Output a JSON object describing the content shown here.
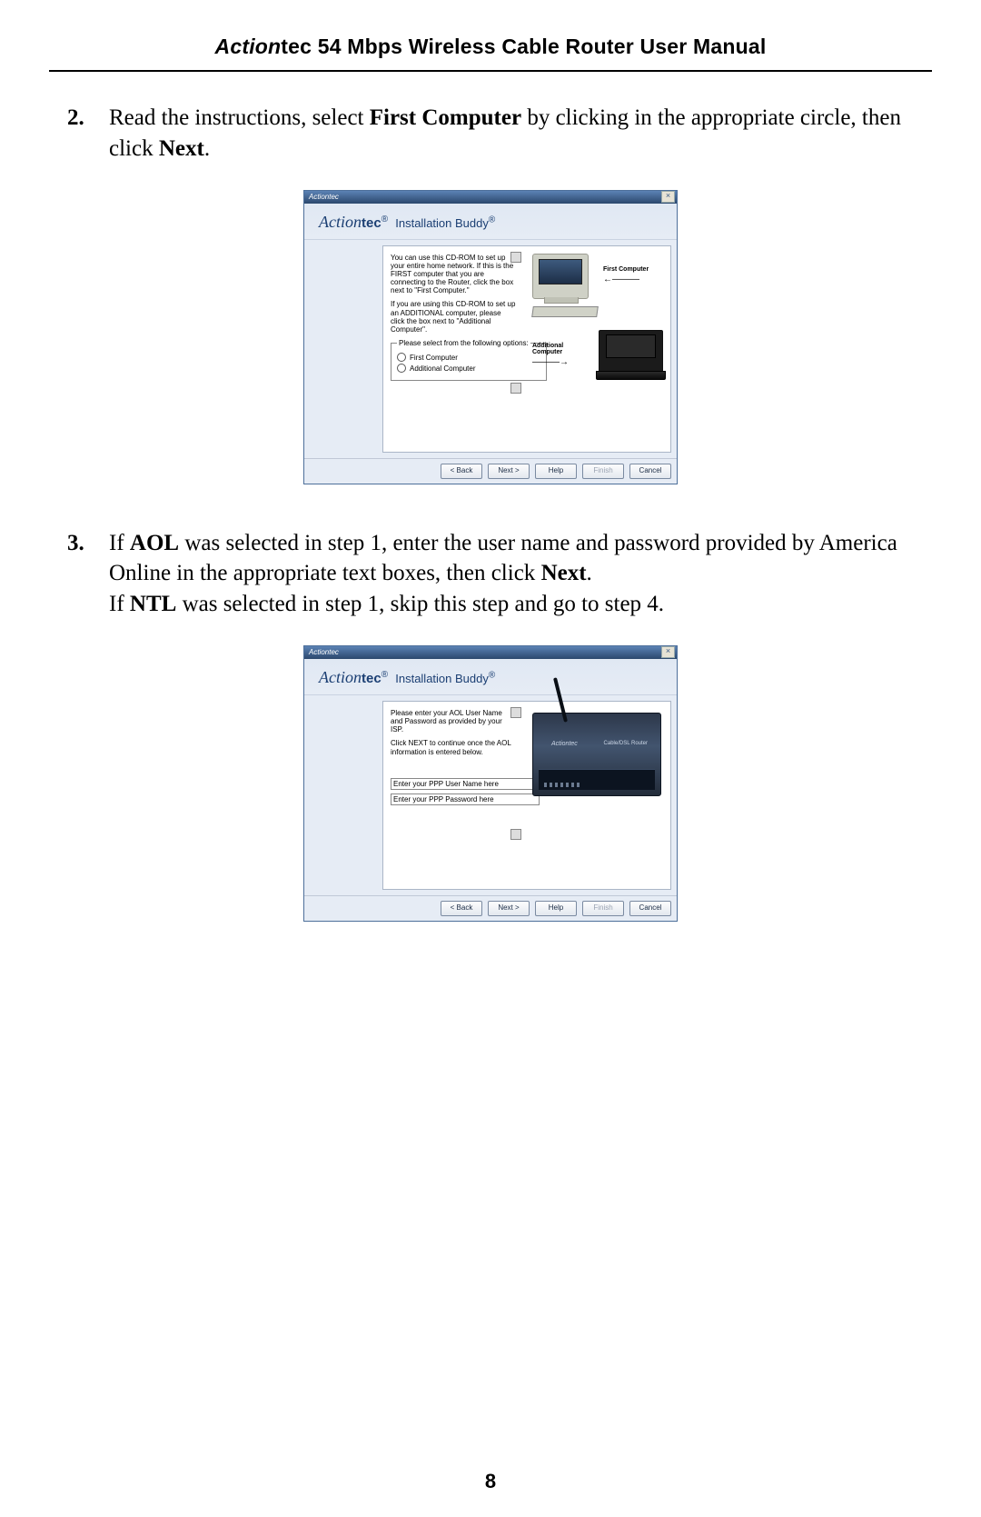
{
  "header": {
    "brand_italic": "Action",
    "brand_rest": "tec 54 Mbps Wireless Cable Router User Manual"
  },
  "steps": {
    "s2": {
      "num": "2.",
      "text_a": "Read the instructions, select ",
      "bold_a": "First Computer",
      "text_b": " by clicking in the appropriate circle, then click ",
      "bold_b": "Next",
      "text_c": "."
    },
    "s3": {
      "num": "3.",
      "line1_a": "If ",
      "line1_bold1": "AOL",
      "line1_b": " was selected in step 1, enter the user name and password provided by America Online in the appropriate text boxes, then click ",
      "line1_bold2": "Next",
      "line1_c": ".",
      "line2_a": "If ",
      "line2_bold": "NTL",
      "line2_b": " was selected in step 1, skip this step and go to step 4."
    }
  },
  "wizard_common": {
    "titlebar_logo": "Actiontec",
    "close": "×",
    "brand_ital": "Action",
    "brand_bold": "tec",
    "brand_reg": "®",
    "product": " Installation Buddy",
    "product_reg": "®",
    "btn_back": "< Back",
    "btn_next": "Next >",
    "btn_help": "Help",
    "btn_finish": "Finish",
    "btn_cancel": "Cancel"
  },
  "wizard1": {
    "instr_p1": "You can use this CD-ROM to set up your entire home network.  If this is the FIRST computer that you are connecting to the Router, click the box next to \"First Computer.\"",
    "instr_p2": "If you are using this CD-ROM to set up an ADDITIONAL computer, please click the box next to \"Additional Computer\".",
    "legend": "Please select from the following options:",
    "opt1": "First Computer",
    "opt2": "Additional Computer",
    "label_first": "First Computer",
    "label_additional": "Additional Computer"
  },
  "wizard2": {
    "instr_p1": "Please enter your AOL User Name and Password as provided by your ISP.",
    "instr_p2": "Click NEXT to continue once the AOL information is entered below.",
    "input_user": "Enter your PPP User Name here",
    "input_pass": "Enter your PPP Password here",
    "router_brand": "Actiontec",
    "router_model": "Cable/DSL Router"
  },
  "page_number": "8"
}
